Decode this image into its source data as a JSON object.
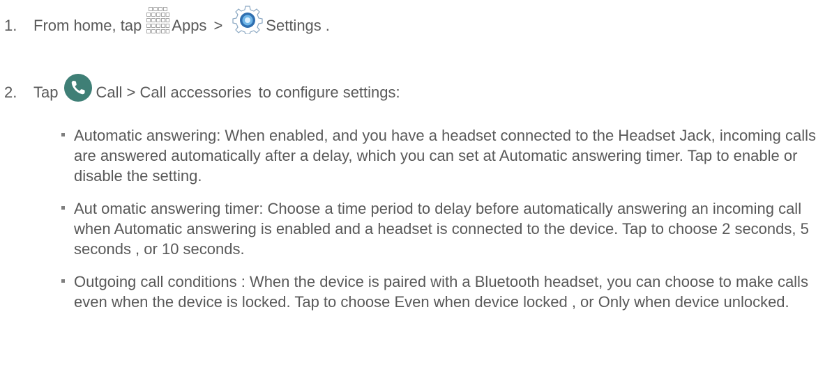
{
  "steps": [
    {
      "number": "1.",
      "text_before": "From home, tap",
      "icon1": "apps-grid-icon",
      "label1": "Apps",
      "separator": ">",
      "icon2": "settings-gear-icon",
      "label2": "Settings",
      "text_after": "."
    },
    {
      "number": "2.",
      "text_before": "Tap",
      "icon1": "phone-call-icon",
      "label1": "Call > Call accessories",
      "text_after": "to configure settings:"
    }
  ],
  "bullets": [
    "Automatic answering: When enabled, and you have a headset connected to the Headset Jack, incoming calls are answered automatically after a delay, which you can set at Automatic answering timer. Tap to enable or disable the setting.",
    "Aut omatic answering timer: Choose a time period to delay before automatically answering an incoming call when Automatic answering is enabled and a headset is connected to the device. Tap to choose 2 seconds, 5 seconds , or 10 seconds.",
    "Outgoing call conditions : When the device is paired with a Bluetooth headset, you can choose to make calls even when the device is locked. Tap to choose Even when device locked , or Only when device unlocked."
  ],
  "colors": {
    "text": "#595959",
    "call_icon_bg": "#3f7f76",
    "gear_icon": "#3b7fbf",
    "apps_icon": "#a6a6a6"
  }
}
